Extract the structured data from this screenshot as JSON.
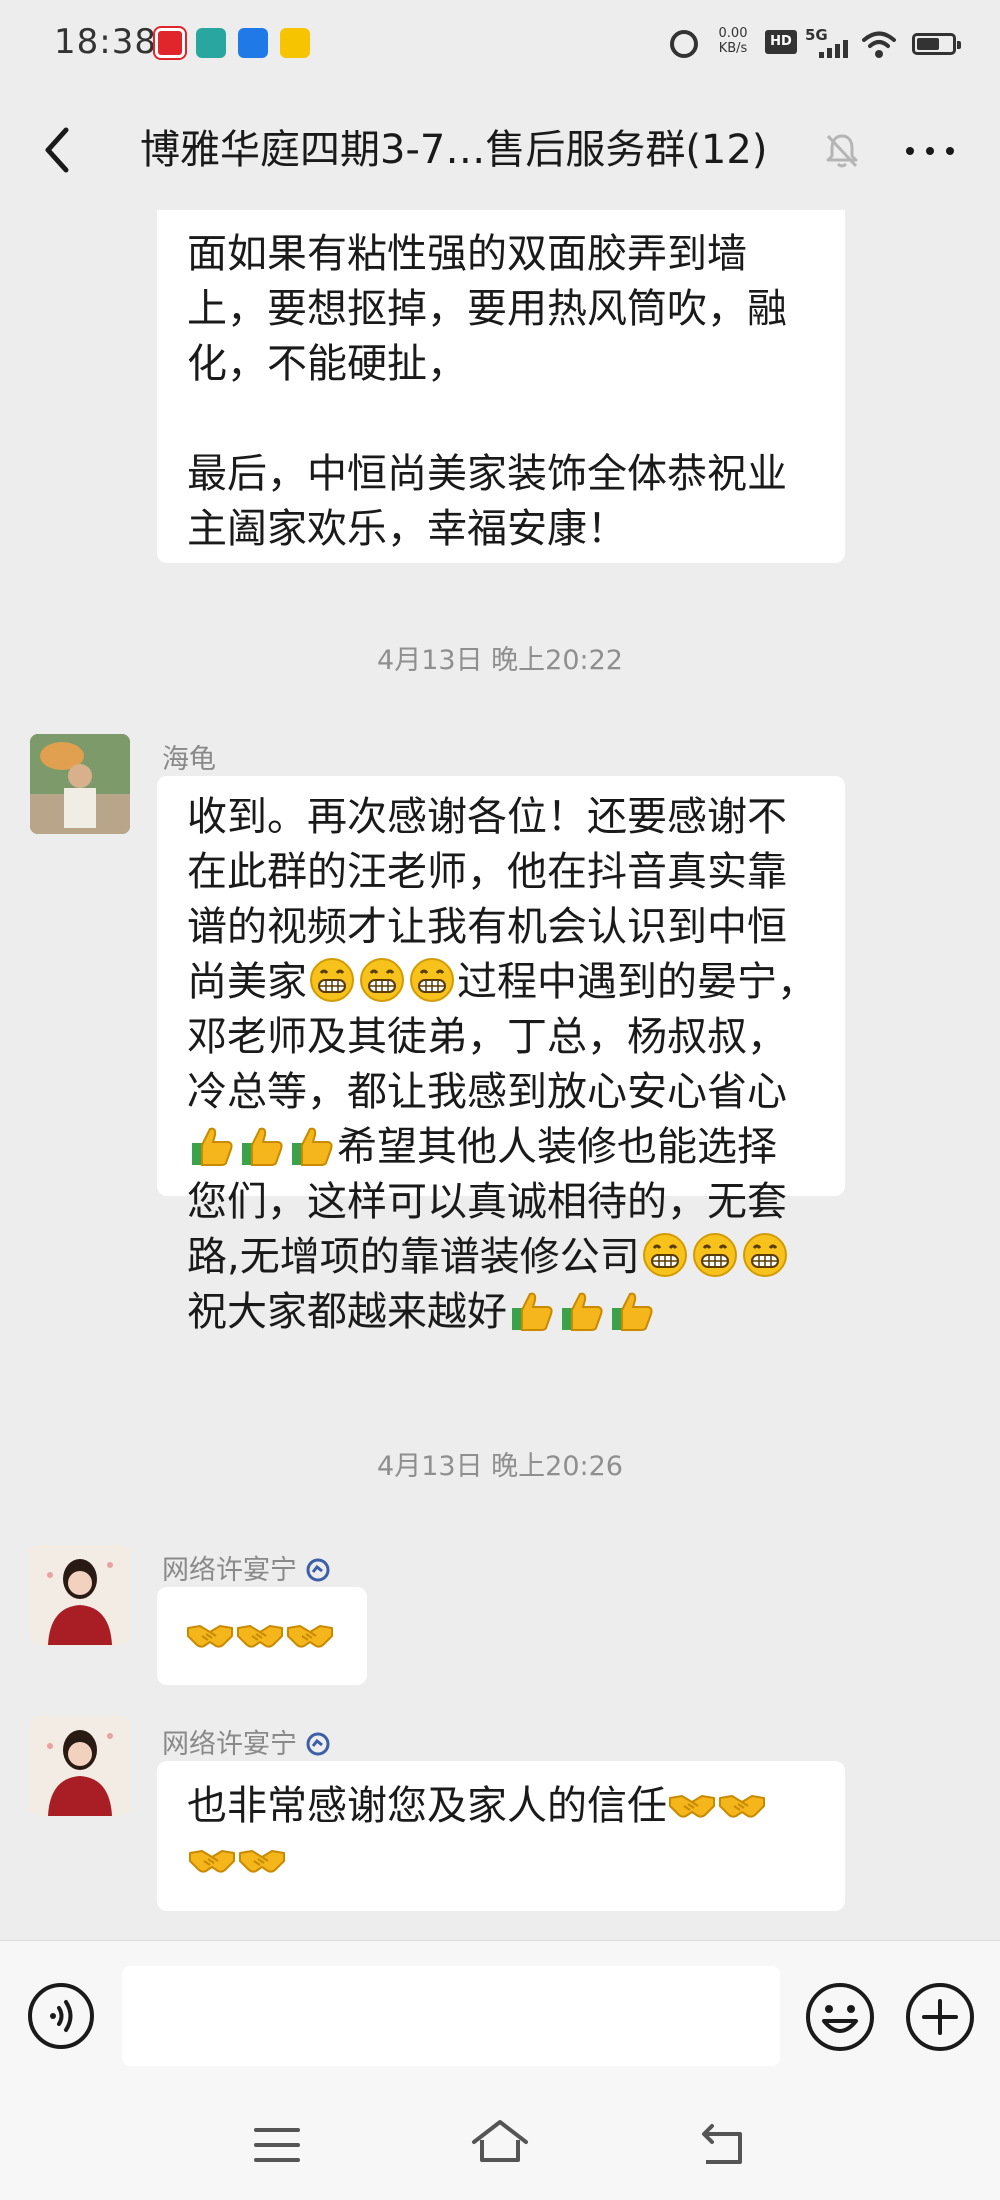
{
  "status_bar": {
    "time": "18:38",
    "net_speed_value": "0.00",
    "net_speed_unit": "KB/s",
    "hd_label": "HD",
    "network_label": "5G",
    "app_icons": [
      "12306-icon",
      "boss-zhipin-icon",
      "app-icon",
      "meituan-icon"
    ]
  },
  "header": {
    "back_icon": "chevron-left-icon",
    "title": "博雅华庭四期3-7…售后服务群(12)",
    "mute_icon": "bell-muted-icon",
    "more_icon": "more-dots-icon"
  },
  "messages": [
    {
      "type": "bubble",
      "lines": [
        "面如果有粘性强的双面胶弄到墙",
        "上，要想抠掉，要用热风筒吹，融",
        "化，不能硬扯，",
        "",
        "最后，中恒尚美家装饰全体恭祝业",
        "主阖家欢乐，幸福安康！"
      ]
    },
    {
      "type": "time",
      "text": "4月13日 晚上20:22"
    },
    {
      "type": "bubble",
      "sender": "海龟",
      "lines": [
        "收到。再次感谢各位！还要感谢不",
        "在此群的汪老师，他在抖音真实靠",
        "谱的视频才让我有机会认识到中恒",
        "尚美家",
        "过程中遇到的晏宁，",
        "邓老师及其徒弟，丁总，杨叔叔，",
        "冷总等，都让我感到放心安心省心",
        "希望其他人装修也能选择",
        "您们，这样可以真诚相待的，无套",
        "路,无增项的靠谱装修公司",
        "祝大家都越来越好"
      ]
    },
    {
      "type": "time",
      "text": "4月13日 晚上20:26"
    },
    {
      "type": "bubble",
      "sender": "网络许宴宁",
      "emoji": "handshake-emoji"
    },
    {
      "type": "bubble",
      "sender": "网络许宴宁",
      "lines": [
        "也非常感谢您及家人的信任"
      ]
    }
  ],
  "emoji_names": {
    "grin": "grinning-emoji",
    "thumbs": "thumbs-up-emoji",
    "handshake": "handshake-emoji"
  },
  "input": {
    "placeholder": "",
    "value": ""
  },
  "colors": {
    "background": "#ededed",
    "bubble": "#ffffff",
    "timestamp": "#8f8f8f",
    "sender": "#8a8a8a",
    "verify": "#3c5fa8"
  }
}
